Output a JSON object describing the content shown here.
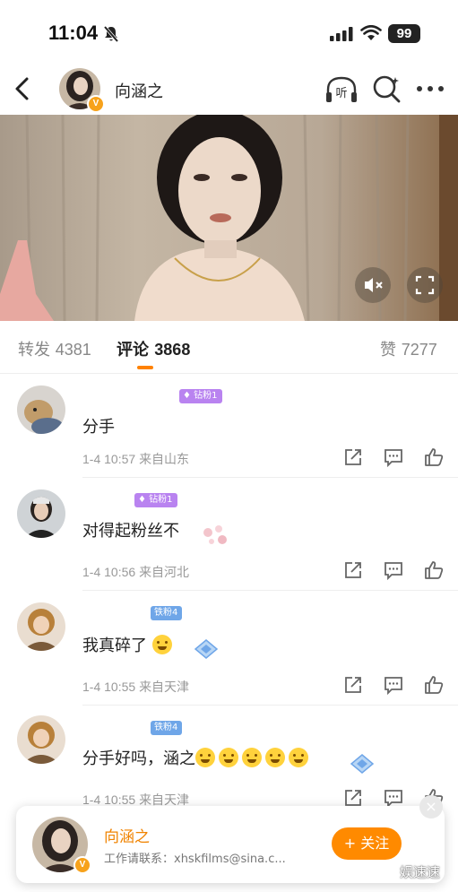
{
  "status_bar": {
    "time": "11:04",
    "battery": "99"
  },
  "header": {
    "title": "向涵之",
    "icons": [
      "back-icon",
      "listen-icon",
      "search-icon",
      "more-icon"
    ]
  },
  "video": {
    "controls": [
      "mute-icon",
      "fullscreen-icon"
    ]
  },
  "tabs": [
    {
      "label": "转发",
      "count": "4381"
    },
    {
      "label": "评论",
      "count": "3868"
    },
    {
      "label": "赞",
      "count": "7277"
    }
  ],
  "comments": [
    {
      "badge": "钻粉1",
      "text": "分手",
      "time": "1-4 10:57",
      "location": "来自山东"
    },
    {
      "badge": "钻粉1",
      "text": "对得起粉丝不",
      "time": "1-4 10:56",
      "location": "来自河北"
    },
    {
      "badge": "铁粉4",
      "text": "我真碎了",
      "time": "1-4 10:55",
      "location": "来自天津"
    },
    {
      "badge": "铁粉4",
      "text": "分手好吗，涵之",
      "time": "1-4 10:55",
      "location": "来自天津"
    }
  ],
  "popup": {
    "name": "向涵之",
    "contact": "工作请联系：xhskfilms@sina.c...",
    "follow_label": "+ 关注",
    "close_label": "×"
  },
  "watermark": "娱速速",
  "colors": {
    "accent": "#ff8200",
    "diamond_badge": "#b983f0",
    "iron_badge": "#6fa6e8"
  }
}
